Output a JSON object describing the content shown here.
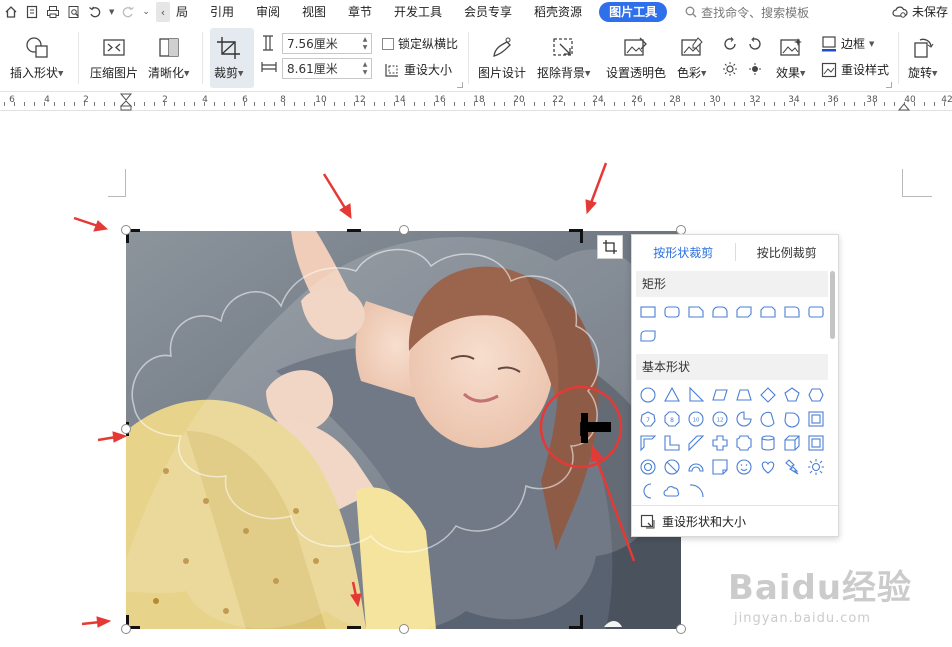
{
  "menubar": {
    "partial_tab": "局",
    "tabs": [
      "引用",
      "审阅",
      "视图",
      "章节",
      "开发工具",
      "会员专享",
      "稻壳资源"
    ],
    "active_tab": "图片工具",
    "search_label": "查找命令、搜索模板",
    "unsaved_label": "未保存"
  },
  "ribbon": {
    "insert_shape": "插入形状",
    "compress": "压缩图片",
    "sharpen": "清晰化",
    "crop": "裁剪",
    "height_value": "7.56厘米",
    "width_value": "8.61厘米",
    "lock_ratio": "锁定纵横比",
    "reset_size": "重设大小",
    "picture_design": "图片设计",
    "remove_bg": "抠除背景",
    "set_transparent": "设置透明色",
    "color": "色彩",
    "effects": "效果",
    "border": "边框",
    "reset_style": "重设样式",
    "rotate": "旋转"
  },
  "ruler": {
    "labels": [
      "6",
      "4",
      "2",
      "2",
      "4",
      "6",
      "8",
      "10",
      "12",
      "14",
      "16",
      "18",
      "20",
      "22",
      "24",
      "26",
      "28",
      "30",
      "32",
      "34",
      "36",
      "38",
      "40",
      "42"
    ]
  },
  "crop_panel": {
    "tab_shape": "按形状裁剪",
    "tab_ratio": "按比例裁剪",
    "section_rect": "矩形",
    "section_basic": "基本形状",
    "reset_shape": "重设形状和大小",
    "accent_color": "#2a6fde"
  },
  "watermark": {
    "brand": "Baidu经验",
    "url": "jingyan.baidu.com"
  },
  "colors": {
    "active_tab_bg": "#2e6fec",
    "annotation_red": "#e53935"
  }
}
